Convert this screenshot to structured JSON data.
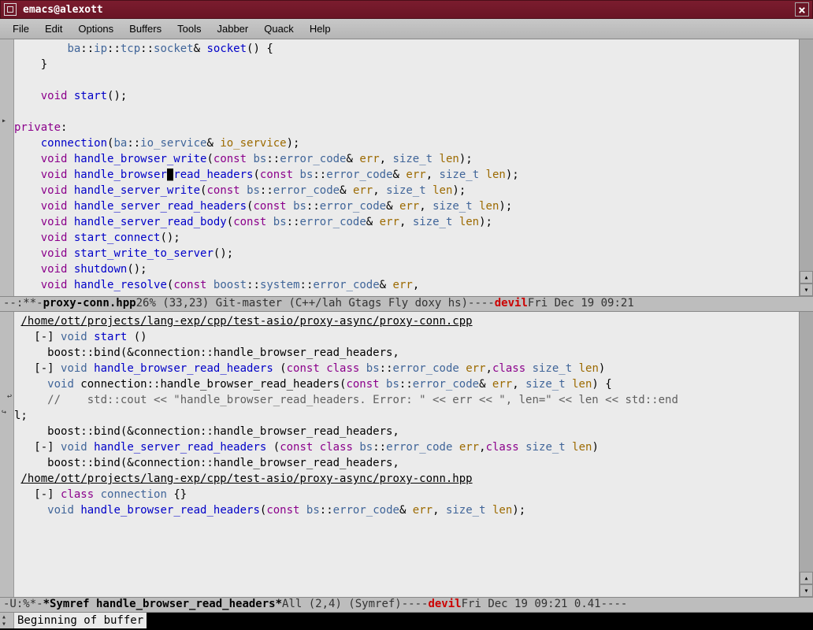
{
  "window": {
    "title": "emacs@alexott"
  },
  "menu": [
    "File",
    "Edit",
    "Options",
    "Buffers",
    "Tools",
    "Jabber",
    "Quack",
    "Help"
  ],
  "upper": {
    "code_html": "        <span class=\"ty\">ba</span>::<span class=\"ty\">ip</span>::<span class=\"ty\">tcp</span>::<span class=\"ty\">socket</span>&amp; <span class=\"fn\">socket</span>() {\n    }\n\n    <span class=\"kw\">void</span> <span class=\"fn\">start</span>();\n\n<span class=\"kw\">private</span>:\n    <span class=\"fn\">connection</span>(<span class=\"ty\">ba</span>::<span class=\"ty\">io_service</span>&amp; <span class=\"va\">io_service</span>);\n    <span class=\"kw\">void</span> <span class=\"fn\">handle_browser_write</span>(<span class=\"kw\">const</span> <span class=\"ty\">bs</span>::<span class=\"ty\">error_code</span>&amp; <span class=\"va\">err</span>, <span class=\"ty\">size_t</span> <span class=\"va\">len</span>);\n    <span class=\"kw\">void</span> <span class=\"fn\">handle_browser<span class=\"cu\">_</span>read_headers</span>(<span class=\"kw\">const</span> <span class=\"ty\">bs</span>::<span class=\"ty\">error_code</span>&amp; <span class=\"va\">err</span>, <span class=\"ty\">size_t</span> <span class=\"va\">len</span>);\n    <span class=\"kw\">void</span> <span class=\"fn\">handle_server_write</span>(<span class=\"kw\">const</span> <span class=\"ty\">bs</span>::<span class=\"ty\">error_code</span>&amp; <span class=\"va\">err</span>, <span class=\"ty\">size_t</span> <span class=\"va\">len</span>);\n    <span class=\"kw\">void</span> <span class=\"fn\">handle_server_read_headers</span>(<span class=\"kw\">const</span> <span class=\"ty\">bs</span>::<span class=\"ty\">error_code</span>&amp; <span class=\"va\">err</span>, <span class=\"ty\">size_t</span> <span class=\"va\">len</span>);\n    <span class=\"kw\">void</span> <span class=\"fn\">handle_server_read_body</span>(<span class=\"kw\">const</span> <span class=\"ty\">bs</span>::<span class=\"ty\">error_code</span>&amp; <span class=\"va\">err</span>, <span class=\"ty\">size_t</span> <span class=\"va\">len</span>);\n    <span class=\"kw\">void</span> <span class=\"fn\">start_connect</span>();\n    <span class=\"kw\">void</span> <span class=\"fn\">start_write_to_server</span>();\n    <span class=\"kw\">void</span> <span class=\"fn\">shutdown</span>();\n    <span class=\"kw\">void</span> <span class=\"fn\">handle_resolve</span>(<span class=\"kw\">const</span> <span class=\"ty\">boost</span>::<span class=\"ty\">system</span>::<span class=\"ty\">error_code</span>&amp; <span class=\"va\">err</span>,"
  },
  "modeline1": {
    "prefix": "--:**-  ",
    "buffer": "proxy-conn.hpp",
    "mid": "   26% (33,23)   Git-master  (C++/lah Gtags Fly doxy hs)----",
    "devil": "devil",
    "tail": "Fri Dec 19 09:21"
  },
  "lower": {
    "code_html": " <span class=\"ul\">/home/ott/projects/lang-exp/cpp/test-asio/proxy-async/proxy-conn.cpp</span>\n   [-] <span class=\"ty\">void</span> <span class=\"fn\">start</span> ()\n     boost::bind(&amp;connection::handle_browser_read_headers,\n   [-] <span class=\"ty\">void</span> <span class=\"fn\">handle_browser_read_headers</span> (<span class=\"kw\">const</span> <span class=\"kw\">class</span> <span class=\"ty\">bs</span>::<span class=\"ty\">error_code</span> <span class=\"va\">err</span>,<span class=\"kw\">class</span> <span class=\"ty\">size_t</span> <span class=\"va\">len</span>)\n     <span class=\"ty\">void</span> connection::handle_browser_read_headers(<span class=\"kw\">const</span> <span class=\"ty\">bs</span>::<span class=\"ty\">error_code</span>&amp; <span class=\"va\">err</span>, <span class=\"ty\">size_t</span> <span class=\"va\">len</span>) {\n     <span class=\"co\">//    std::cout &lt;&lt; \"handle_browser_read_headers. Error: \" &lt;&lt; err &lt;&lt; \", len=\" &lt;&lt; len &lt;&lt; std::end</span>\nl;\n     boost::bind(&amp;connection::handle_browser_read_headers,\n   [-] <span class=\"ty\">void</span> <span class=\"fn\">handle_server_read_headers</span> (<span class=\"kw\">const</span> <span class=\"kw\">class</span> <span class=\"ty\">bs</span>::<span class=\"ty\">error_code</span> <span class=\"va\">err</span>,<span class=\"kw\">class</span> <span class=\"ty\">size_t</span> <span class=\"va\">len</span>)\n     boost::bind(&amp;connection::handle_browser_read_headers,\n <span class=\"ul\">/home/ott/projects/lang-exp/cpp/test-asio/proxy-async/proxy-conn.hpp</span>\n   [-] <span class=\"kw\">class</span> <span class=\"ty\">connection</span> {}\n     <span class=\"ty\">void</span> <span class=\"fn\">handle_browser_read_headers</span>(<span class=\"kw\">const</span> <span class=\"ty\">bs</span>::<span class=\"ty\">error_code</span>&amp; <span class=\"va\">err</span>, <span class=\"ty\">size_t</span> <span class=\"va\">len</span>);"
  },
  "modeline2": {
    "prefix": "-U:%*-  ",
    "buffer": "*Symref handle_browser_read_headers*",
    "mid": "   All (2,4)      (Symref)----",
    "devil": "devil",
    "tail": "Fri Dec 19 09:21 0.41----"
  },
  "minibuffer": "Beginning of buffer"
}
